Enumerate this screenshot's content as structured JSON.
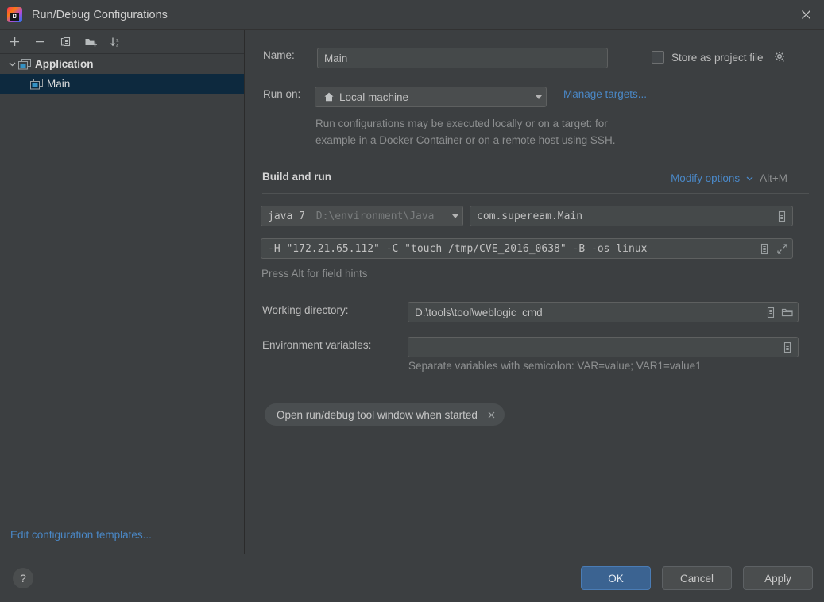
{
  "window": {
    "title": "Run/Debug Configurations",
    "app_icon": "intellij-idea-logo",
    "close_icon": "close-icon"
  },
  "sidebar": {
    "toolbar": [
      {
        "name": "add-configuration-button",
        "icon": "plus-icon",
        "tooltip": "Add New Configuration"
      },
      {
        "name": "remove-configuration-button",
        "icon": "minus-icon",
        "tooltip": "Remove Configuration"
      },
      {
        "name": "copy-configuration-button",
        "icon": "copy-icon",
        "tooltip": "Copy Configuration"
      },
      {
        "name": "new-folder-button",
        "icon": "new-folder-icon",
        "tooltip": "Create New Folder"
      },
      {
        "name": "sort-configurations-button",
        "icon": "sort-alphabetically-icon",
        "tooltip": "Sort Configurations"
      }
    ],
    "tree": [
      {
        "label": "Application",
        "level": 0,
        "expanded": true,
        "selected": false,
        "icon": "application-icon"
      },
      {
        "label": "Main",
        "level": 1,
        "expanded": false,
        "selected": true,
        "icon": "application-icon"
      }
    ],
    "footer_link": "Edit configuration templates..."
  },
  "form": {
    "name_label": "Name:",
    "name_value": "Main",
    "name_placeholder": "",
    "store_as_project_file": {
      "label": "Store as project file",
      "checked": false,
      "gear_icon": "gear-dropdown-icon"
    },
    "run_on_label": "Run on:",
    "run_on_value": "Local machine",
    "run_on_icon": "home-icon",
    "manage_targets_link": "Manage targets...",
    "run_on_hint_line1": "Run configurations may be executed locally or on a target: for",
    "run_on_hint_line2": "example in a Docker Container or on a remote host using SSH.",
    "build_and_run_title": "Build and run",
    "modify_options_link": "Modify options",
    "modify_options_shortcut": "Alt+M",
    "jdk_name": "java 7",
    "jdk_path": "D:\\environment\\Java",
    "main_class_value": "com.supeream.Main",
    "program_arguments_value": "-H \"172.21.65.112\" -C \"touch /tmp/CVE_2016_0638\" -B -os linux",
    "field_hint": "Press Alt for field hints",
    "working_directory_label": "Working directory:",
    "working_directory_value": "D:\\tools\\tool\\weblogic_cmd",
    "environment_variables_label": "Environment variables:",
    "environment_variables_value": "",
    "environment_variables_hint": "Separate variables with semicolon: VAR=value; VAR1=value1",
    "option_chip": {
      "label": "Open run/debug tool window when started",
      "remove_icon": "close-small-icon"
    },
    "icons": {
      "macro_icon": "insert-macro-icon",
      "expand_icon": "expand-editor-icon",
      "browse_icon": "browse-folder-icon"
    }
  },
  "footer": {
    "help_label": "?",
    "ok_label": "OK",
    "cancel_label": "Cancel",
    "apply_label": "Apply"
  },
  "colors": {
    "background": "#3c3f41",
    "selection": "#0d293e",
    "link": "#4a88c7",
    "primary_button": "#3b6391",
    "field_background": "#45494a",
    "text": "#bbbbbb",
    "dim_text": "#8d8f90"
  }
}
